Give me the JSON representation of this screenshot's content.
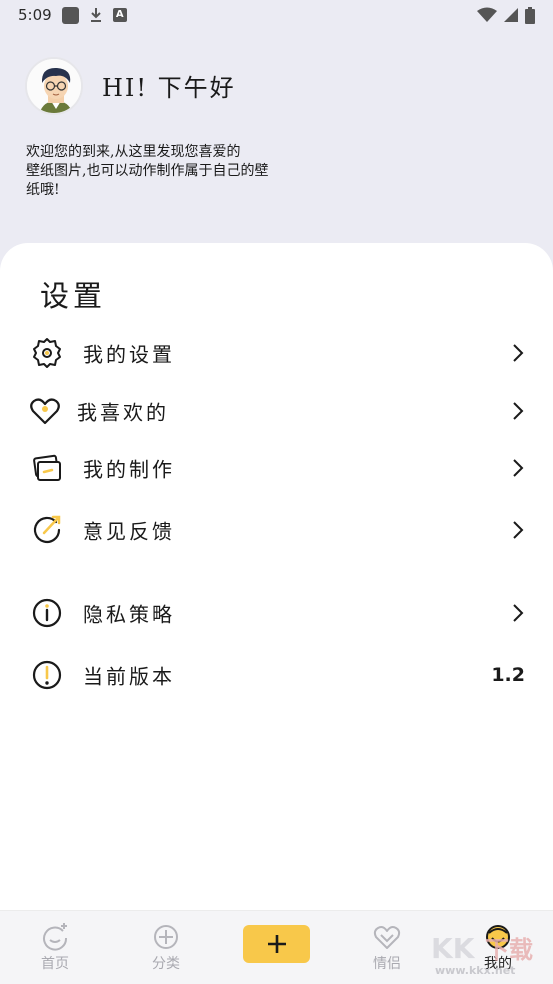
{
  "status_bar": {
    "time": "5:09",
    "icons": [
      "notification-square-icon",
      "download-icon",
      "text-app-icon",
      "wifi-icon",
      "signal-icon",
      "battery-icon"
    ]
  },
  "header": {
    "greeting": "HI! 下午好",
    "welcome_line1": "欢迎您的到来,从这里发现您喜爱的",
    "welcome_line2": "壁纸图片,也可以动作制作属于自己的壁",
    "welcome_line3": "纸哦!"
  },
  "settings": {
    "title": "设置",
    "items": [
      {
        "label": "我的设置",
        "icon": "gear-icon"
      },
      {
        "label": "我喜欢的",
        "icon": "heart-icon"
      },
      {
        "label": "我的制作",
        "icon": "cards-icon"
      },
      {
        "label": "意见反馈",
        "icon": "feedback-icon"
      },
      {
        "label": "隐私策略",
        "icon": "info-icon"
      },
      {
        "label": "当前版本",
        "icon": "alert-icon",
        "value": "1.2"
      }
    ]
  },
  "tab_bar": {
    "tabs": [
      {
        "label": "首页",
        "icon": "home-icon"
      },
      {
        "label": "分类",
        "icon": "category-icon"
      },
      {
        "label": "",
        "icon": "plus-icon"
      },
      {
        "label": "情侣",
        "icon": "couple-icon"
      },
      {
        "label": "我的",
        "icon": "profile-icon"
      }
    ],
    "active_index": 4
  },
  "watermark": {
    "line1": "KK下载",
    "line2": "www.kkx.net"
  },
  "colors": {
    "accent": "#f8c84a",
    "background": "#ebebf3",
    "card": "#ffffff"
  }
}
